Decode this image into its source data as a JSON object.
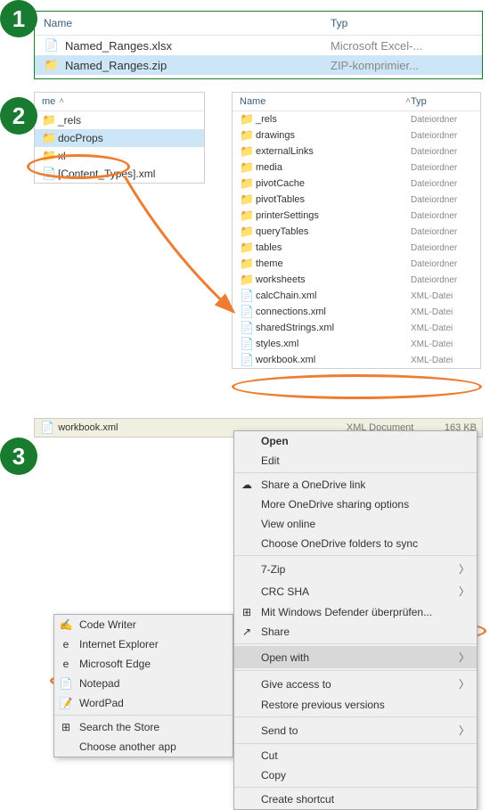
{
  "step1": {
    "headers": {
      "name": "Name",
      "typ": "Typ"
    },
    "rows": [
      {
        "name": "Named_Ranges.xlsx",
        "typ": "Microsoft Excel-..."
      },
      {
        "name": "Named_Ranges.zip",
        "typ": "ZIP-komprimier..."
      }
    ]
  },
  "step2": {
    "left_header": "me",
    "left_rows": [
      "_rels",
      "docProps",
      "xl",
      "[Content_Types].xml"
    ],
    "right_header_name": "Name",
    "right_header_typ": "Typ",
    "right_rows": [
      {
        "n": "_rels",
        "t": "Dateiordner",
        "f": true
      },
      {
        "n": "drawings",
        "t": "Dateiordner",
        "f": true
      },
      {
        "n": "externalLinks",
        "t": "Dateiordner",
        "f": true
      },
      {
        "n": "media",
        "t": "Dateiordner",
        "f": true
      },
      {
        "n": "pivotCache",
        "t": "Dateiordner",
        "f": true
      },
      {
        "n": "pivotTables",
        "t": "Dateiordner",
        "f": true
      },
      {
        "n": "printerSettings",
        "t": "Dateiordner",
        "f": true
      },
      {
        "n": "queryTables",
        "t": "Dateiordner",
        "f": true
      },
      {
        "n": "tables",
        "t": "Dateiordner",
        "f": true
      },
      {
        "n": "theme",
        "t": "Dateiordner",
        "f": true
      },
      {
        "n": "worksheets",
        "t": "Dateiordner",
        "f": true
      },
      {
        "n": "calcChain.xml",
        "t": "XML-Datei",
        "f": false
      },
      {
        "n": "connections.xml",
        "t": "XML-Datei",
        "f": false
      },
      {
        "n": "sharedStrings.xml",
        "t": "XML-Datei",
        "f": false
      },
      {
        "n": "styles.xml",
        "t": "XML-Datei",
        "f": false
      },
      {
        "n": "workbook.xml",
        "t": "XML-Datei",
        "f": false
      }
    ]
  },
  "step3": {
    "file": {
      "name": "workbook.xml",
      "type": "XML Document",
      "size": "163 KB"
    },
    "menu": [
      {
        "label": "Open",
        "bold": true
      },
      {
        "label": "Edit"
      },
      {
        "sep": true
      },
      {
        "label": "Share a OneDrive link",
        "icon": "☁"
      },
      {
        "label": "More OneDrive sharing options"
      },
      {
        "label": "View online"
      },
      {
        "label": "Choose OneDrive folders to sync"
      },
      {
        "sep": true
      },
      {
        "label": "7-Zip",
        "sub": true
      },
      {
        "label": "CRC SHA",
        "sub": true
      },
      {
        "label": "Mit Windows Defender überprüfen...",
        "icon": "⊞"
      },
      {
        "label": "Share",
        "icon": "↗"
      },
      {
        "sep": true
      },
      {
        "label": "Open with",
        "sub": true,
        "hl": true
      },
      {
        "sep": true
      },
      {
        "label": "Give access to",
        "sub": true
      },
      {
        "label": "Restore previous versions"
      },
      {
        "sep": true
      },
      {
        "label": "Send to",
        "sub": true
      },
      {
        "sep": true
      },
      {
        "label": "Cut"
      },
      {
        "label": "Copy"
      },
      {
        "sep": true
      },
      {
        "label": "Create shortcut"
      }
    ],
    "submenu": [
      {
        "label": "Code Writer",
        "icon": "✍"
      },
      {
        "label": "Internet Explorer",
        "icon": "e"
      },
      {
        "label": "Microsoft Edge",
        "icon": "e"
      },
      {
        "label": "Notepad",
        "icon": "📄",
        "hl": true
      },
      {
        "label": "WordPad",
        "icon": "📝"
      },
      {
        "sep": true
      },
      {
        "label": "Search the Store",
        "icon": "⊞"
      },
      {
        "label": "Choose another app"
      }
    ]
  },
  "badges": {
    "s1": "1",
    "s2": "2",
    "s3": "3"
  }
}
